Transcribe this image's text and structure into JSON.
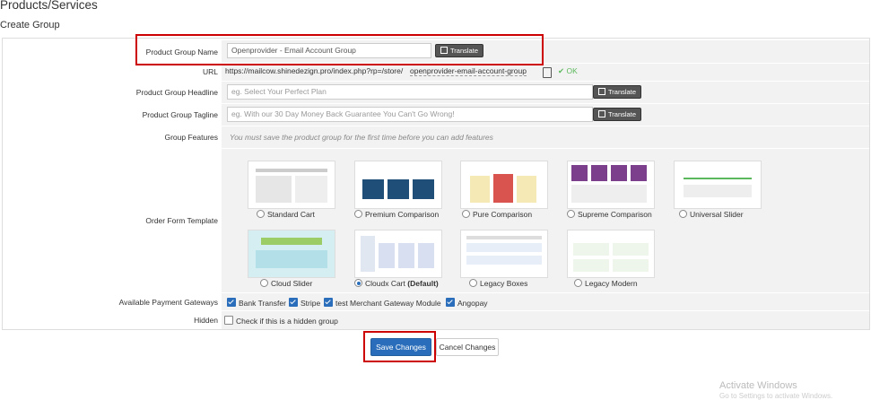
{
  "header": {
    "title": "Products/Services",
    "subtitle": "Create Group"
  },
  "form": {
    "group_name": {
      "label": "Product Group Name",
      "value": "Openprovider - Email Account Group",
      "translate": "Translate"
    },
    "url": {
      "label": "URL",
      "base": "https://mailcow.shinedezign.pro/index.php?rp=/store/",
      "slug": "openprovider-email-account-group",
      "status": "OK"
    },
    "headline": {
      "label": "Product Group Headline",
      "placeholder": "eg. Select Your Perfect Plan",
      "translate": "Translate"
    },
    "tagline": {
      "label": "Product Group Tagline",
      "placeholder": "eg. With our 30 Day Money Back Guarantee You Can't Go Wrong!",
      "translate": "Translate"
    },
    "features": {
      "label": "Group Features",
      "note": "You must save the product group for the first time before you can add features"
    },
    "templates": {
      "label": "Order Form Template",
      "items": [
        {
          "name": "Standard Cart",
          "selected": false
        },
        {
          "name": "Premium Comparison",
          "selected": false
        },
        {
          "name": "Pure Comparison",
          "selected": false
        },
        {
          "name": "Supreme Comparison",
          "selected": false
        },
        {
          "name": "Universal Slider",
          "selected": false
        },
        {
          "name": "Cloud Slider",
          "selected": false
        },
        {
          "name": "Cloudx Cart",
          "suffix": "(Default)",
          "selected": true
        },
        {
          "name": "Legacy Boxes",
          "selected": false
        },
        {
          "name": "Legacy Modern",
          "selected": false
        }
      ]
    },
    "gateways": {
      "label": "Available Payment Gateways",
      "items": [
        {
          "name": "Bank Transfer",
          "checked": true
        },
        {
          "name": "Stripe",
          "checked": true
        },
        {
          "name": "test Merchant Gateway Module",
          "checked": true
        },
        {
          "name": "Angopay",
          "checked": true
        }
      ]
    },
    "hidden": {
      "label": "Hidden",
      "checkbox_label": "Check if this is a hidden group",
      "checked": false
    }
  },
  "actions": {
    "save": "Save Changes",
    "cancel": "Cancel Changes"
  },
  "watermark": {
    "line1": "Activate Windows",
    "line2": "Go to Settings to activate Windows."
  }
}
